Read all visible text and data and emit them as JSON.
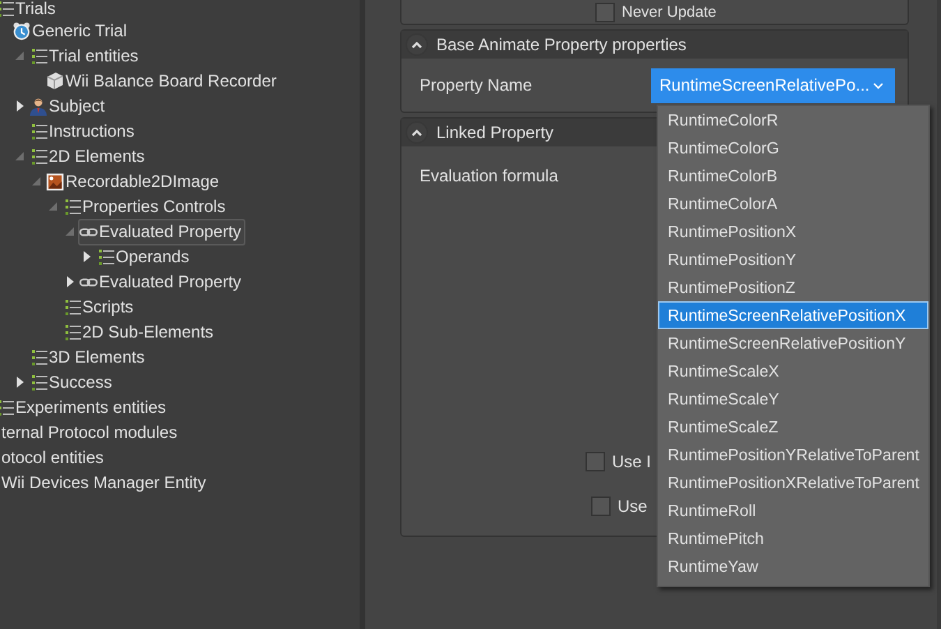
{
  "tree": {
    "items": [
      {
        "label": "Trials",
        "kind": "group",
        "selected": false,
        "children": [
          {
            "label": "Generic Trial",
            "kind": "trial",
            "selected": false,
            "children": [
              {
                "label": "Trial entities",
                "kind": "group",
                "selected": false,
                "expanded": true,
                "children": [
                  {
                    "label": "Wii Balance Board Recorder",
                    "kind": "device",
                    "selected": false
                  }
                ]
              },
              {
                "label": "Subject",
                "kind": "subject",
                "selected": false,
                "expanded": false
              },
              {
                "label": "Instructions",
                "kind": "group",
                "selected": false
              },
              {
                "label": "2D Elements",
                "kind": "group",
                "selected": false,
                "expanded": true,
                "children": [
                  {
                    "label": "Recordable2DImage",
                    "kind": "image",
                    "selected": false,
                    "expanded": true,
                    "children": [
                      {
                        "label": "Properties Controls",
                        "kind": "group",
                        "selected": false,
                        "expanded": true,
                        "children": [
                          {
                            "label": "Evaluated Property",
                            "kind": "link",
                            "selected": true,
                            "expanded": true,
                            "children": [
                              {
                                "label": "Operands",
                                "kind": "group",
                                "selected": false,
                                "expanded": false
                              }
                            ]
                          },
                          {
                            "label": "Evaluated Property",
                            "kind": "link",
                            "selected": false,
                            "expanded": false
                          }
                        ]
                      },
                      {
                        "label": "Scripts",
                        "kind": "group",
                        "selected": false
                      },
                      {
                        "label": "2D Sub-Elements",
                        "kind": "group",
                        "selected": false
                      }
                    ]
                  }
                ]
              },
              {
                "label": "3D Elements",
                "kind": "group",
                "selected": false
              },
              {
                "label": "Success",
                "kind": "group",
                "selected": false,
                "expanded": false
              }
            ]
          }
        ]
      },
      {
        "label": "Experiments entities",
        "kind": "group",
        "selected": false
      },
      {
        "label": "ternal Protocol modules",
        "kind": "none",
        "selected": false
      },
      {
        "label": "otocol entities",
        "kind": "none",
        "selected": false
      },
      {
        "label": "Wii Devices Manager Entity",
        "kind": "none",
        "selected": false
      }
    ]
  },
  "top_panel": {
    "checkbox": {
      "label": "Never Update",
      "checked": false
    }
  },
  "panels": [
    {
      "title": "Base Animate Property properties",
      "expanded": true,
      "fields": [
        {
          "kind": "dropdown",
          "label": "Property Name",
          "value": "RuntimeScreenRelativePo..."
        }
      ]
    },
    {
      "title": "Linked Property",
      "expanded": true,
      "fields": [
        {
          "kind": "text",
          "label": "Evaluation formula"
        },
        {
          "kind": "checkbox",
          "label": "Use I",
          "checked": false
        },
        {
          "kind": "checkbox",
          "label": "Use",
          "checked": false
        }
      ]
    }
  ],
  "dropdown_menu": {
    "options": [
      {
        "label": "RuntimeColorR",
        "selected": false
      },
      {
        "label": "RuntimeColorG",
        "selected": false
      },
      {
        "label": "RuntimeColorB",
        "selected": false
      },
      {
        "label": "RuntimeColorA",
        "selected": false
      },
      {
        "label": "RuntimePositionX",
        "selected": false
      },
      {
        "label": "RuntimePositionY",
        "selected": false
      },
      {
        "label": "RuntimePositionZ",
        "selected": false
      },
      {
        "label": "RuntimeScreenRelativePositionX",
        "selected": true
      },
      {
        "label": "RuntimeScreenRelativePositionY",
        "selected": false
      },
      {
        "label": "RuntimeScaleX",
        "selected": false
      },
      {
        "label": "RuntimeScaleY",
        "selected": false
      },
      {
        "label": "RuntimeScaleZ",
        "selected": false
      },
      {
        "label": "RuntimePositionYRelativeToParent",
        "selected": false
      },
      {
        "label": "RuntimePositionXRelativeToParent",
        "selected": false
      },
      {
        "label": "RuntimeRoll",
        "selected": false
      },
      {
        "label": "RuntimePitch",
        "selected": false
      },
      {
        "label": "RuntimeYaw",
        "selected": false
      }
    ]
  }
}
